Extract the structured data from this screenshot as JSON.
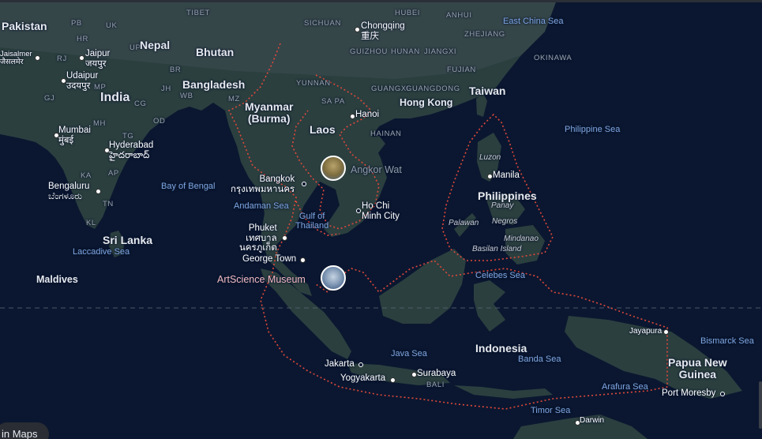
{
  "colors": {
    "water": "#0b1730",
    "land": "#2b3f3f",
    "land_north": "#3a4a4f",
    "border": "#e0483b",
    "equator": "#5a6775"
  },
  "icons": {
    "angkor_wat": "landmark-photo",
    "artscience_museum": "landmark-photo"
  },
  "countries": {
    "pakistan": "Pakistan",
    "nepal": "Nepal",
    "bhutan": "Bhutan",
    "bangladesh": "Bangladesh",
    "india": "India",
    "sri_lanka": "Sri Lanka",
    "maldives": "Maldives",
    "myanmar": "Myanmar\n(Burma)",
    "laos": "Laos",
    "taiwan": "Taiwan",
    "philippines": "Philippines",
    "indonesia": "Indonesia",
    "png": "Papua New\nGuinea"
  },
  "regions": {
    "tibet": "TIBET",
    "hubei": "HUBEI",
    "anhui": "ANHUI",
    "sichuan": "SICHUAN",
    "zhejiang": "ZHEJIANG",
    "guizhou": "GUIZHOU",
    "hunan": "HUNAN",
    "jiangxi": "JIANGXI",
    "fujian": "FUJIAN",
    "yunnan": "YUNNAN",
    "guangxi": "GUANGXI",
    "guangdong": "GUANGDONG",
    "hainan": "HAINAN",
    "okinawa": "OKINAWA",
    "sa_pa": "SA PA",
    "bali": "BALI",
    "pb": "PB",
    "uk": "UK",
    "hr": "HR",
    "up": "UP",
    "rj": "RJ",
    "br": "BR",
    "jh": "JH",
    "wb": "WB",
    "mp": "MP",
    "gj": "GJ",
    "mh": "MH",
    "cg": "CG",
    "od": "OD",
    "tg": "TG",
    "ap": "AP",
    "ka": "KA",
    "tn": "TN",
    "kl": "KL",
    "mz": "MZ"
  },
  "cities": {
    "chongqing": "Chongqing\n重庆",
    "jaisalmer": "Jaisalmer\nजैसलमेर",
    "jaipur": "Jaipur\nजयपुर",
    "udaipur": "Udaipur\nउदयपुर",
    "mumbai": "Mumbai\nमुंबई",
    "hyderabad": "Hyderabad\nహైదరాబాద్",
    "bengaluru": "Bengaluru\nಬೆಂಗಳೂರು",
    "hanoi": "Hanoi",
    "hong_kong": "Hong Kong",
    "bangkok": "Bangkok\nกรุงเทพมหานคร",
    "ho_chi_minh": "Ho Chi\nMinh City",
    "phuket": "Phuket\nเทศบาล\nนครภูเก็ต",
    "george_town": "George Town",
    "manila": "Manila",
    "jakarta": "Jakarta",
    "yogyakarta": "Yogyakarta",
    "surabaya": "Surabaya",
    "jayapura": "Jayapura",
    "port_moresby": "Port Moresby",
    "darwin": "Darwin"
  },
  "seas": {
    "east_china": "East China Sea",
    "philippine": "Philippine Sea",
    "bay_of_bengal": "Bay of Bengal",
    "andaman": "Andaman Sea",
    "gulf_thailand": "Gulf of\nThailand",
    "laccadive": "Laccadive Sea",
    "celebes": "Celebes Sea",
    "java": "Java Sea",
    "banda": "Banda Sea",
    "bismarck": "Bismarck Sea",
    "arafura": "Arafura Sea",
    "timor": "Timor Sea"
  },
  "islands": {
    "luzon": "Luzon",
    "panay": "Panay",
    "negros": "Negros",
    "palawan": "Palawan",
    "mindanao": "Mindanao",
    "basilan": "Basilan Island"
  },
  "pois": {
    "angkor_wat": "Angkor Wat",
    "artscience": "ArtScience Museum"
  },
  "controls": {
    "open_in_maps": "in Maps"
  }
}
